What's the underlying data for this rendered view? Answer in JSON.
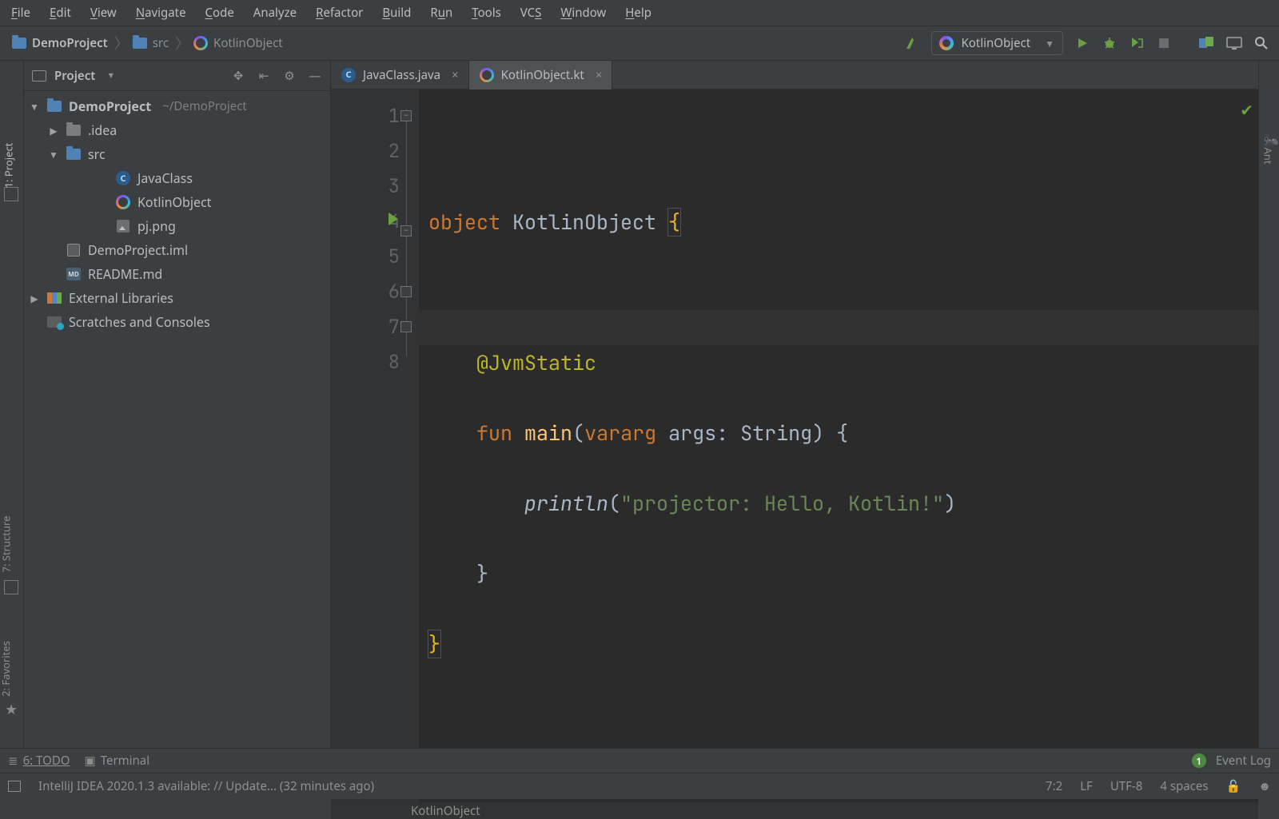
{
  "menu": {
    "items": [
      {
        "pre": "",
        "u": "F",
        "post": "ile"
      },
      {
        "pre": "",
        "u": "E",
        "post": "dit"
      },
      {
        "pre": "",
        "u": "V",
        "post": "iew"
      },
      {
        "pre": "",
        "u": "N",
        "post": "avigate"
      },
      {
        "pre": "",
        "u": "C",
        "post": "ode"
      },
      {
        "pre": "",
        "u": "",
        "post": "Analyze"
      },
      {
        "pre": "",
        "u": "R",
        "post": "efactor"
      },
      {
        "pre": "",
        "u": "B",
        "post": "uild"
      },
      {
        "pre": "R",
        "u": "u",
        "post": "n"
      },
      {
        "pre": "",
        "u": "T",
        "post": "ools"
      },
      {
        "pre": "VC",
        "u": "S",
        "post": ""
      },
      {
        "pre": "",
        "u": "W",
        "post": "indow"
      },
      {
        "pre": "",
        "u": "H",
        "post": "elp"
      }
    ]
  },
  "breadcrumbs": {
    "items": [
      "DemoProject",
      "src",
      "KotlinObject"
    ]
  },
  "run_config": {
    "selected": "KotlinObject"
  },
  "sidebars": {
    "left": {
      "project": "1: Project",
      "structure": "7: Structure",
      "favorites": "2: Favorites"
    },
    "right": {
      "ant": "Ant"
    }
  },
  "tree": {
    "header": "Project",
    "nodes": [
      {
        "ind": 0,
        "arrow": "down",
        "icon": "folder",
        "label": "DemoProject",
        "bold": true,
        "sub": "~/DemoProject"
      },
      {
        "ind": 1,
        "arrow": "right",
        "icon": "folder-grey",
        "label": ".idea"
      },
      {
        "ind": 1,
        "arrow": "down",
        "icon": "folder",
        "label": "src"
      },
      {
        "ind": 2,
        "arrow": "none",
        "icon": "java",
        "label": "JavaClass"
      },
      {
        "ind": 2,
        "arrow": "none",
        "icon": "kotlin",
        "label": "KotlinObject"
      },
      {
        "ind": 2,
        "arrow": "none",
        "icon": "image",
        "label": "pj.png"
      },
      {
        "ind": 1,
        "arrow": "none",
        "icon": "iml",
        "label": "DemoProject.iml"
      },
      {
        "ind": 1,
        "arrow": "none",
        "icon": "md",
        "label": "README.md"
      },
      {
        "ind": 0,
        "arrow": "right",
        "icon": "lib",
        "label": "External Libraries"
      },
      {
        "ind": 0,
        "arrow": "none",
        "icon": "scr",
        "label": "Scratches and Consoles"
      }
    ]
  },
  "tabs": [
    {
      "icon": "java",
      "label": "JavaClass.java",
      "active": false
    },
    {
      "icon": "kotlin",
      "label": "KotlinObject.kt",
      "active": true
    }
  ],
  "editor": {
    "lang": "kotlin",
    "line_count": 8,
    "run_gutter_line": 4,
    "caret_line": 7,
    "breadcrumb": "KotlinObject",
    "code": {
      "l1_kw": "object",
      "l1_name": " KotlinObject ",
      "l1_brace": "{",
      "l3_anno": "@JvmStatic",
      "l4_kw": "fun",
      "l4_name": " main",
      "l4_open": "(",
      "l4_varg": "vararg",
      "l4_args": " args: String) {",
      "l5_call": "println",
      "l5_open": "(",
      "l5_str": "\"projector: Hello, Kotlin!\"",
      "l5_close": ")",
      "l6": "}",
      "l7": "}"
    }
  },
  "bottom_tools": {
    "todo": "6: TODO",
    "terminal": "Terminal",
    "event_log": "Event Log",
    "event_count": "1"
  },
  "status": {
    "msg": "IntelliJ IDEA 2020.1.3 available: // Update... (32 minutes ago)",
    "pos": "7:2",
    "le": "LF",
    "enc": "UTF-8",
    "indent": "4 spaces"
  }
}
